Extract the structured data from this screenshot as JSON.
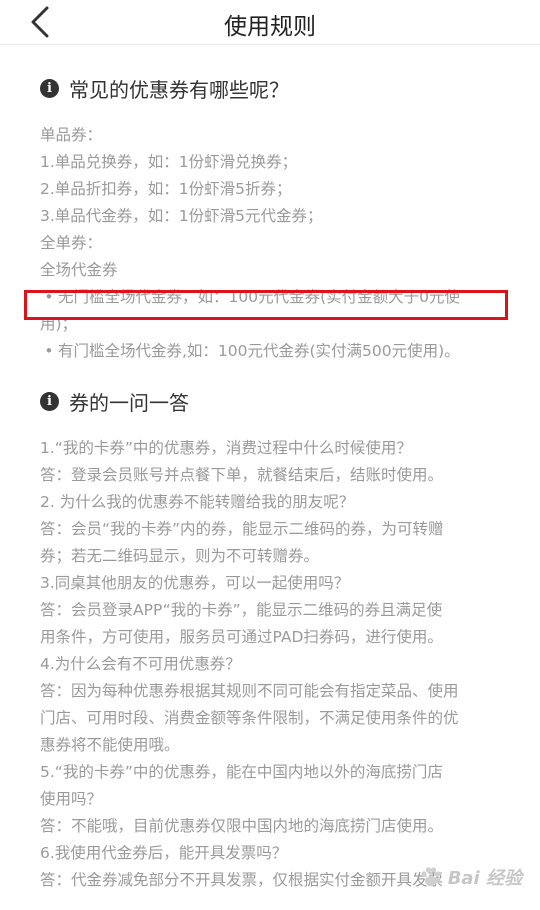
{
  "header": {
    "title": "使用规则"
  },
  "section1": {
    "title": "常见的优惠券有哪些呢？",
    "lines": [
      "单品券：",
      "1.单品兑换券，如：1份虾滑兑换券；",
      "2.单品折扣券，如：1份虾滑5折券；",
      "3.单品代金券，如：1份虾滑5元代金券；",
      "全单券：",
      "全场代金券"
    ],
    "bullet1_a": "无门槛全场代金券，如：100元代金券(实付金额大于0元使",
    "bullet1_b": "用)；",
    "bullet2": "有门槛全场代金券,如：100元代金券(实付满500元使用)。"
  },
  "section2": {
    "title": "券的一问一答",
    "lines": [
      "1.“我的卡券”中的优惠券，消费过程中什么时候使用？",
      "答：登录会员账号并点餐下单，就餐结束后，结账时使用。",
      "2. 为什么我的优惠券不能转赠给我的朋友呢？",
      "答：会员“我的卡券”内的券，能显示二维码的券，为可转赠",
      "券；若无二维码显示，则为不可转赠券。",
      "3.同桌其他朋友的优惠券，可以一起使用吗？",
      "答：会员登录APP“我的卡券”，能显示二维码的券且满足使",
      "用条件，方可使用，服务员可通过PAD扫券码，进行使用。",
      "4.为什么会有不可用优惠券？",
      "答：因为每种优惠券根据其规则不同可能会有指定菜品、使用",
      "门店、可用时段、消费金额等条件限制，不满足使用条件的优",
      "惠券将不能使用哦。",
      "5.“我的卡券”中的优惠券，能在中国内地以外的海底捞门店",
      "使用吗？",
      "答：不能哦，目前优惠券仅限中国内地的海底捞门店使用。",
      "6.我使用代金券后，能开具发票吗？",
      "答：代金券减免部分不开具发票，仅根据实付金额开具发票"
    ]
  },
  "watermark": {
    "text": "Bai 经验"
  },
  "colors": {
    "highlight": "#d9141b",
    "text": "#9a9a9a",
    "heading": "#333333"
  }
}
